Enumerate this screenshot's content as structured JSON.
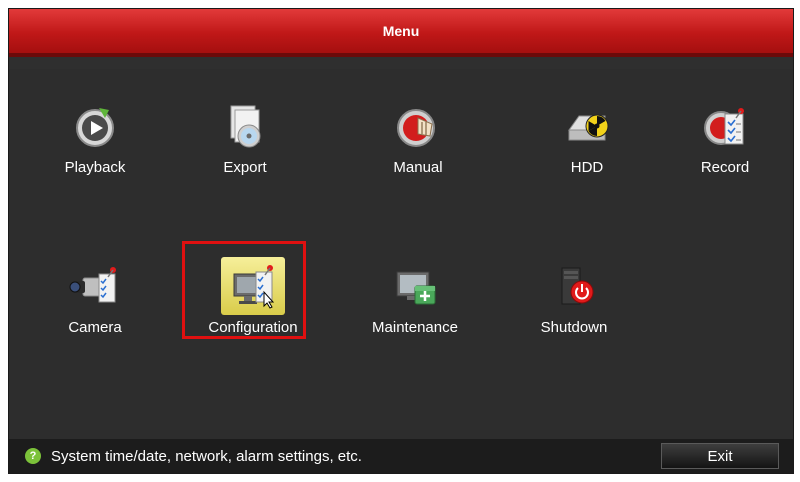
{
  "window": {
    "title": "Menu"
  },
  "tiles": [
    {
      "label": "Playback",
      "icon": "playback-icon"
    },
    {
      "label": "Export",
      "icon": "export-icon"
    },
    {
      "label": "Manual",
      "icon": "manual-icon"
    },
    {
      "label": "HDD",
      "icon": "hdd-icon"
    },
    {
      "label": "Record",
      "icon": "record-icon"
    },
    {
      "label": "Camera",
      "icon": "camera-icon"
    },
    {
      "label": "Configuration",
      "icon": "configuration-icon",
      "selected": true
    },
    {
      "label": "Maintenance",
      "icon": "maintenance-icon"
    },
    {
      "label": "Shutdown",
      "icon": "shutdown-icon"
    }
  ],
  "status": {
    "icon": "help-icon",
    "text": "System time/date, network, alarm settings, etc."
  },
  "buttons": {
    "exit_label": "Exit"
  },
  "colors": {
    "title_bar": "#c01818",
    "background": "#2d2d2d",
    "selection_border": "#e01010",
    "status_icon": "#7cc23a"
  }
}
